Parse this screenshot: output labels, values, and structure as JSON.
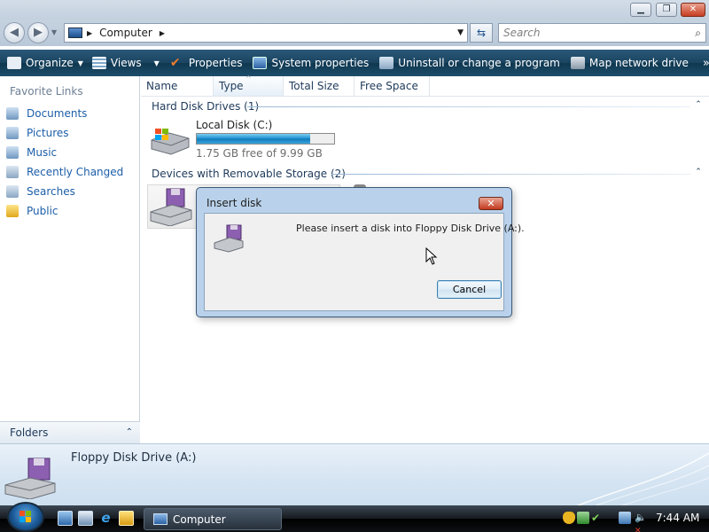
{
  "window": {
    "minimize_glyph": "▁",
    "maximize_glyph": "❐",
    "close_glyph": "✕"
  },
  "address": {
    "back_glyph": "◀",
    "forward_glyph": "▶",
    "path_root": "Computer",
    "refresh_glyph": "⇆",
    "search_placeholder": "Search"
  },
  "toolbar": {
    "organize": "Organize",
    "views": "Views",
    "properties": "Properties",
    "system_properties": "System properties",
    "uninstall": "Uninstall or change a program",
    "map_drive": "Map network drive",
    "more": "»",
    "help": "?"
  },
  "nav": {
    "favorite_links": "Favorite Links",
    "items": [
      {
        "label": "Documents"
      },
      {
        "label": "Pictures"
      },
      {
        "label": "Music"
      },
      {
        "label": "Recently Changed"
      },
      {
        "label": "Searches"
      },
      {
        "label": "Public"
      }
    ],
    "folders": "Folders"
  },
  "columns": {
    "name": "Name",
    "type": "Type",
    "total_size": "Total Size",
    "free_space": "Free Space"
  },
  "groups": {
    "hard_disk": {
      "header": "Hard Disk Drives (1)",
      "drive_name": "Local Disk (C:)",
      "free_text": "1.75 GB free of 9.99 GB",
      "used_fraction": 0.825
    },
    "removable": {
      "header": "Devices with Removable Storage (2)"
    }
  },
  "details": {
    "title": "Floppy Disk Drive (A:)"
  },
  "dialog": {
    "title": "Insert disk",
    "message": "Please insert a disk into Floppy Disk Drive (A:).",
    "cancel": "Cancel",
    "close_glyph": "✕"
  },
  "taskbar": {
    "task_label": "Computer",
    "clock": "7:44 AM"
  },
  "colors": {
    "accent": "#1c5ea8",
    "progress": "#26a0da",
    "toolbar": "#1a4460"
  }
}
